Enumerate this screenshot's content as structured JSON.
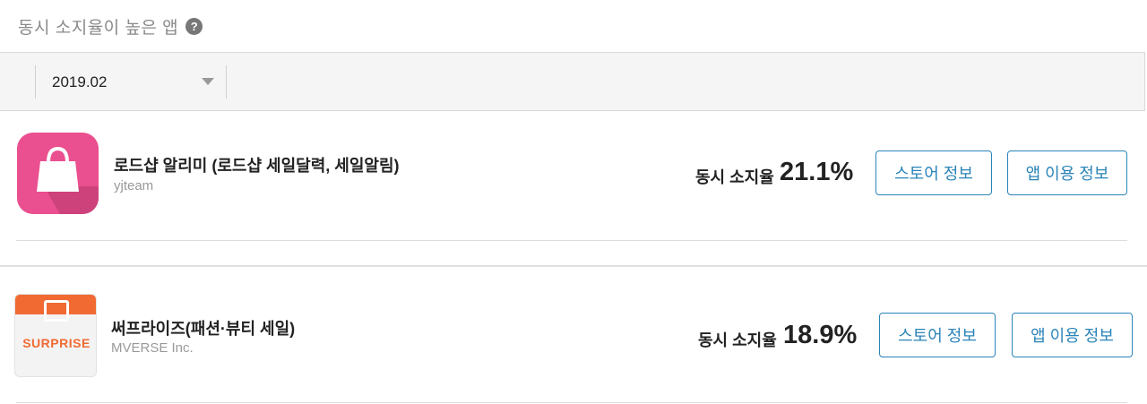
{
  "header": {
    "title": "동시 소지율이 높은 앱",
    "help_icon": "?"
  },
  "filter": {
    "month_value": "2019.02"
  },
  "apps": [
    {
      "name": "로드샵 알리미 (로드샵 세일달력, 세일알림)",
      "developer": "yjteam",
      "rate_label": "동시 소지율",
      "rate_value": "21.1%",
      "store_button": "스토어 정보",
      "usage_button": "앱 이용 정보",
      "icon": "shopping-bag-icon",
      "icon_color": "#ea4f8f"
    },
    {
      "name": "써프라이즈(패션·뷰티 세일)",
      "developer": "MVERSE Inc.",
      "rate_label": "동시 소지율",
      "rate_value": "18.9%",
      "store_button": "스토어 정보",
      "usage_button": "앱 이용 정보",
      "icon": "surprise-logo-icon",
      "icon_text": "SURPRISE",
      "icon_color": "#f06a32"
    }
  ],
  "colors": {
    "accent": "#2a84b8",
    "muted_text": "#999999"
  }
}
